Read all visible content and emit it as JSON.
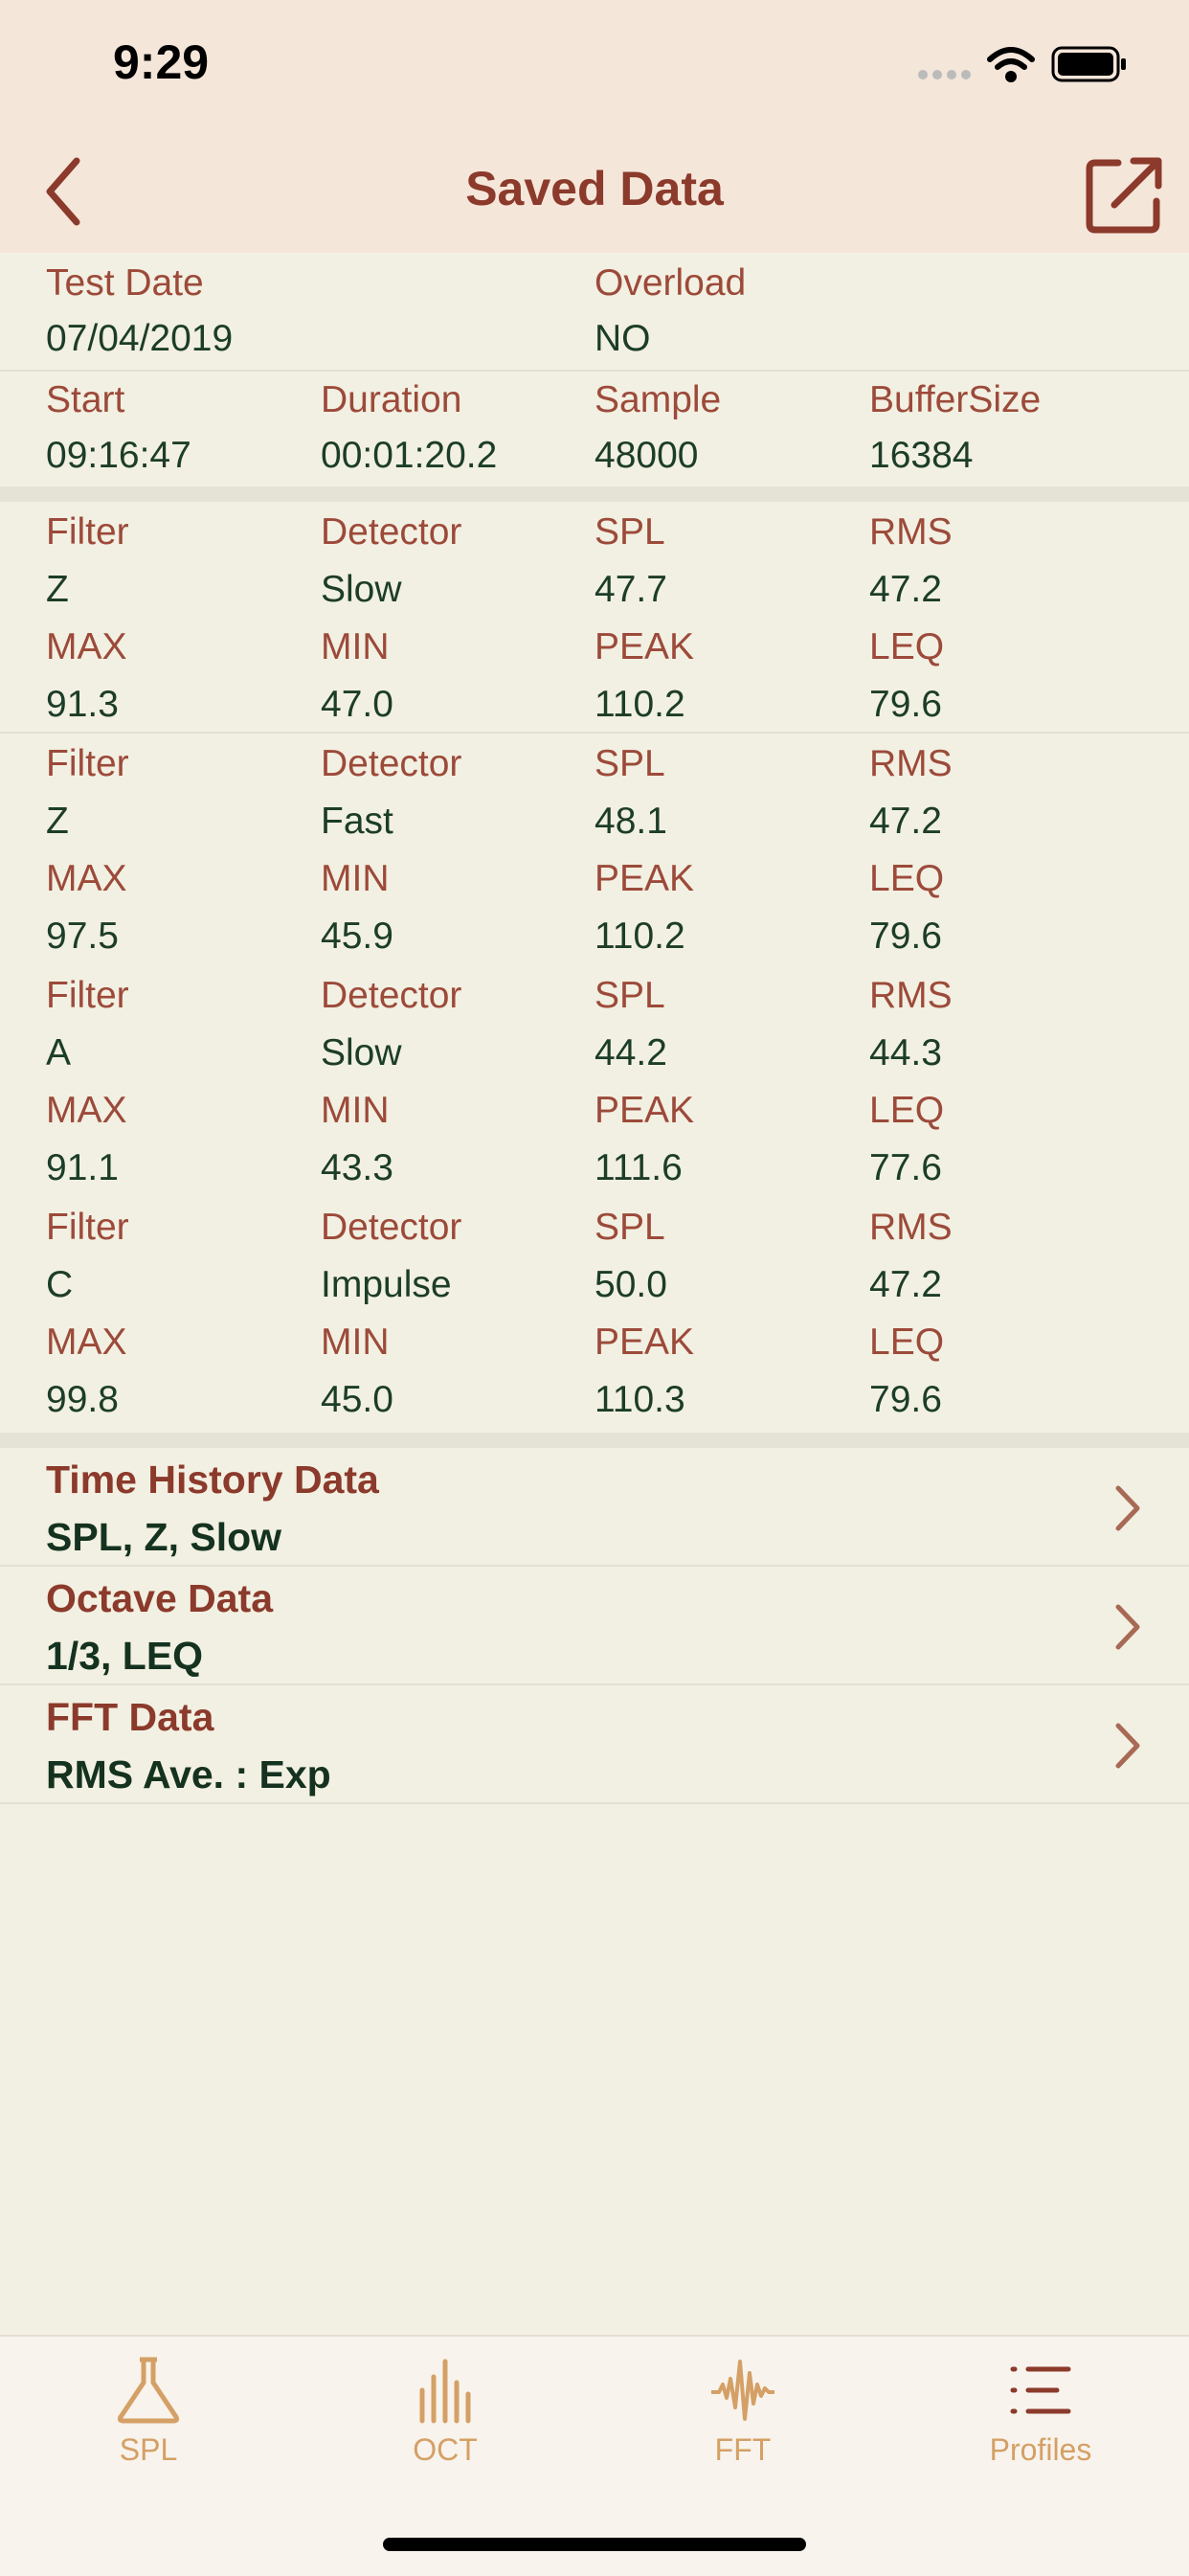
{
  "status": {
    "time": "9:29"
  },
  "nav": {
    "title": "Saved Data"
  },
  "summary": {
    "test_date_label": "Test Date",
    "test_date": "07/04/2019",
    "overload_label": "Overload",
    "overload": "NO",
    "start_label": "Start",
    "start": "09:16:47",
    "duration_label": "Duration",
    "duration": "00:01:20.2",
    "sample_label": "Sample",
    "sample": "48000",
    "buffer_label": "BufferSize",
    "buffer": "16384"
  },
  "measurements": [
    {
      "h1": [
        "Filter",
        "Detector",
        "SPL",
        "RMS"
      ],
      "v1": [
        "Z",
        "Slow",
        "47.7",
        "47.2"
      ],
      "h2": [
        "MAX",
        "MIN",
        "PEAK",
        "LEQ"
      ],
      "v2": [
        "91.3",
        "47.0",
        "110.2",
        "79.6"
      ]
    },
    {
      "h1": [
        "Filter",
        "Detector",
        "SPL",
        "RMS"
      ],
      "v1": [
        "Z",
        "Fast",
        "48.1",
        "47.2"
      ],
      "h2": [
        "MAX",
        "MIN",
        "PEAK",
        "LEQ"
      ],
      "v2": [
        "97.5",
        "45.9",
        "110.2",
        "79.6"
      ]
    },
    {
      "h1": [
        "Filter",
        "Detector",
        "SPL",
        "RMS"
      ],
      "v1": [
        "A",
        "Slow",
        "44.2",
        "44.3"
      ],
      "h2": [
        "MAX",
        "MIN",
        "PEAK",
        "LEQ"
      ],
      "v2": [
        "91.1",
        "43.3",
        "111.6",
        "77.6"
      ]
    },
    {
      "h1": [
        "Filter",
        "Detector",
        "SPL",
        "RMS"
      ],
      "v1": [
        "C",
        "Impulse",
        "50.0",
        "47.2"
      ],
      "h2": [
        "MAX",
        "MIN",
        "PEAK",
        "LEQ"
      ],
      "v2": [
        "99.8",
        "45.0",
        "110.3",
        "79.6"
      ]
    }
  ],
  "links": [
    {
      "title": "Time History Data",
      "subtitle": "SPL, Z, Slow"
    },
    {
      "title": "Octave Data",
      "subtitle": "1/3, LEQ"
    },
    {
      "title": "FFT Data",
      "subtitle": "RMS Ave. : Exp"
    }
  ],
  "tabs": [
    {
      "label": "SPL",
      "icon": "flask-icon"
    },
    {
      "label": "OCT",
      "icon": "octave-bars-icon"
    },
    {
      "label": "FFT",
      "icon": "waveform-icon"
    },
    {
      "label": "Profiles",
      "icon": "list-icon"
    }
  ],
  "colors": {
    "accent": "#8b3a2b",
    "value": "#1c3d28",
    "tab": "#d4a066",
    "background": "#f2f0e2"
  }
}
